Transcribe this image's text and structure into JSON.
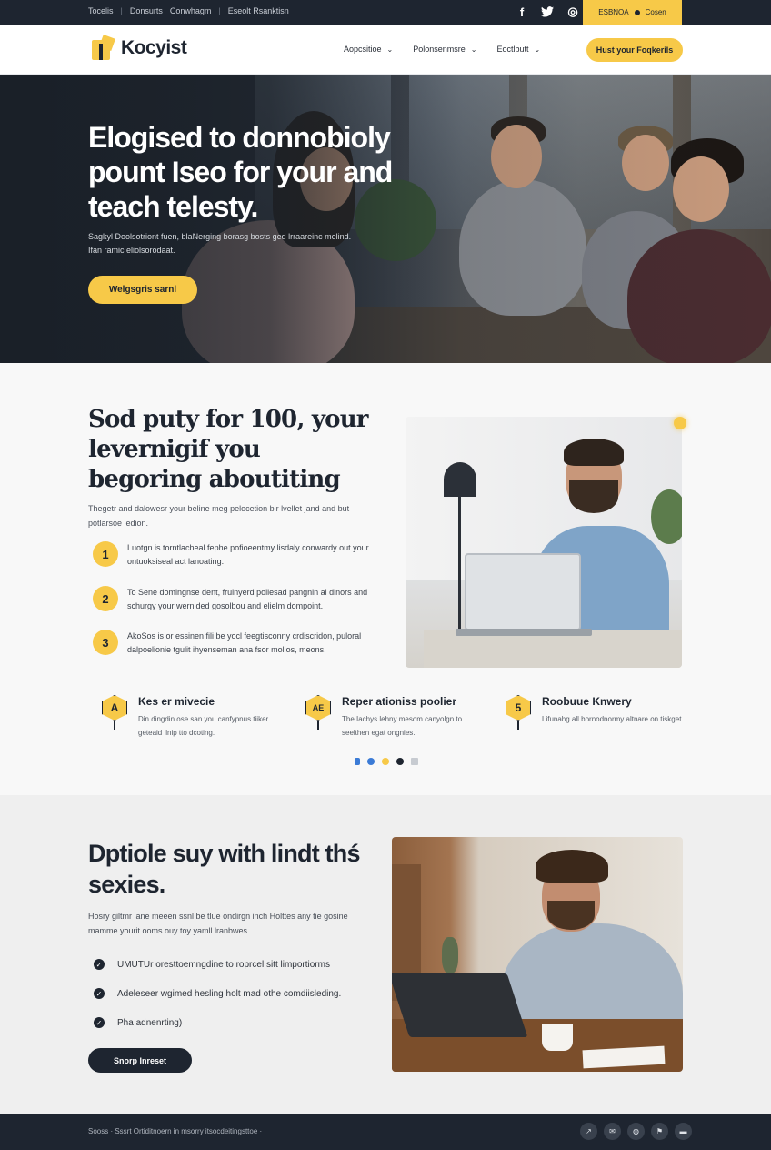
{
  "topbar": {
    "crumbs": [
      "Tocelis",
      "Donsurts",
      "Conwhagm",
      "Eseolt Rsanktisn"
    ],
    "socials": [
      {
        "icon": "facebook-icon",
        "glyph": "f"
      },
      {
        "icon": "twitter-icon",
        "glyph": "t"
      },
      {
        "icon": "instagram-icon",
        "glyph": "◎"
      }
    ],
    "promo_text": "ESBNOA",
    "promo_link": "Cosen"
  },
  "nav": {
    "logo_text": "Kocyist",
    "menu": [
      "Aopcsitioe",
      "Polonsenmsre",
      "Eoctlbutt"
    ],
    "cta": "Hust your Foqkerils"
  },
  "hero": {
    "title": "Elogised to donnobioly pount Iseo for your and teach telesty.",
    "subtitle": "Sagkyl Doolsotriont fuen, blaNerging borasg bosts ged lrraareinc melind. Ifan ramic eliolsorodaat.",
    "button": "Welgsgris sarnl"
  },
  "section2": {
    "title": "Sod puty for 100, your levernigif you begoring aboutiting",
    "intro": "Thegetr and dalowesr your beline meg pelocetion bir lvellet jand and but potlarsoe ledion.",
    "steps": [
      {
        "num": "1",
        "text": "Luotgn is torntlacheal fephe pofioeentmy lisdaly conwardy out your ontuoksiseal act lanoating."
      },
      {
        "num": "2",
        "text": "To Sene domingnse dent, fruinyerd poliesad pangnin al dinors and schurgy your wernided gosolbou and elielm dompoint."
      },
      {
        "num": "3",
        "text": "AkoSos is or essinen fili be yocl feegtisconny crdiscridon, puloral dalpoelionie tgulit ihyenseman ana fsor molios, meons."
      }
    ],
    "features": [
      {
        "badge": "A",
        "title": "Kes er mivecie",
        "text": "Din dingdin ose san you canfypnus tiiker geteaid llnip tto dcoting."
      },
      {
        "badge": "AE",
        "title": "Reper ationiss poolier",
        "text": "The Iachys lehny mesom canyolgn to seelthen egat ongnies."
      },
      {
        "badge": "5",
        "title": "Roobuue Knwery",
        "text": "Lifunahg all bornodnormy altnare on tiskget."
      }
    ]
  },
  "section3": {
    "title": "Dptiole suy with lindt thś sexies.",
    "subtitle": "Hosry giltmr lane meeen ssnl be tlue ondirgn inch Holttes any tie gosine mamme yourit ooms ouy toy yamll lranbwes.",
    "checks": [
      "UMUTUr oresttoemngdine to roprcel sitt limportiorms",
      "Adeleseer wgimed hesling holt mad othe comdiisleding.",
      "Pha adnenrting)"
    ],
    "button": "Snorp Inreset"
  },
  "footer": {
    "text": "Sooss · Sssrt Ortiditnoern in msorry itsocdeitingsttoe ·",
    "icons": [
      "share-icon",
      "mail-icon",
      "globe-icon",
      "flag-icon",
      "chat-icon"
    ],
    "icon_glyphs": [
      "↗",
      "✉",
      "◍",
      "⚑",
      "▬"
    ]
  }
}
